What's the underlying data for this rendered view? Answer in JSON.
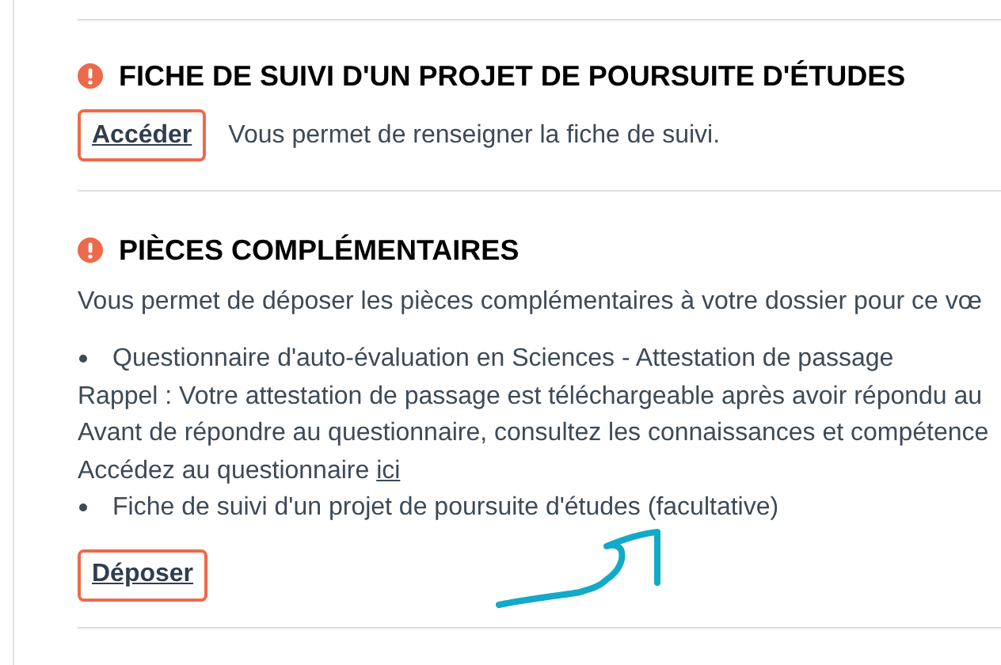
{
  "sections": [
    {
      "title": "FICHE DE SUIVI D'UN PROJET DE POURSUITE D'ÉTUDES",
      "button": "Accéder",
      "button_note": "Vous permet de renseigner la fiche de suivi."
    },
    {
      "title": "PIÈCES COMPLÉMENTAIRES",
      "intro": "Vous permet de déposer les pièces complémentaires à votre dossier pour ce vœ",
      "lines": [
        {
          "kind": "bullet",
          "text": "Questionnaire d'auto-évaluation en Sciences - Attestation de passage"
        },
        {
          "kind": "plain",
          "text": "Rappel : Votre attestation de passage est téléchargeable après avoir répondu au"
        },
        {
          "kind": "plain",
          "text": "Avant de répondre au questionnaire, consultez les connaissances et compétence"
        },
        {
          "kind": "link_line",
          "text": "Accédez au questionnaire",
          "link": "ici"
        },
        {
          "kind": "bullet",
          "text": "Fiche de suivi d'un projet de poursuite d'études (facultative)"
        }
      ],
      "button": "Déposer"
    }
  ]
}
